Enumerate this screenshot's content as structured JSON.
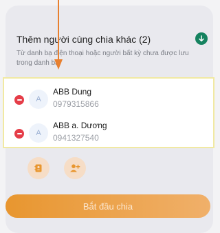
{
  "section": {
    "title": "Thêm người cùng chia khác (2)",
    "description": "Từ danh bạ điện thoại hoặc người bất kỳ chưa được lưu trong danh bạ"
  },
  "contacts": [
    {
      "avatar": "A",
      "name": "ABB Dung",
      "phone": "0979315866"
    },
    {
      "avatar": "A",
      "name": "ABB a. Dương",
      "phone": "0941327540"
    }
  ],
  "actions": {
    "start_label": "Bắt đầu chia"
  },
  "icons": {
    "expand": "chevron-down-icon",
    "remove": "minus-circle-icon",
    "contacts_book": "contacts-book-icon",
    "add_user": "add-user-icon"
  },
  "colors": {
    "accent": "#e8962f",
    "remove": "#e53d48",
    "confirm": "#15825f",
    "highlight_border": "#f1e9a2"
  }
}
